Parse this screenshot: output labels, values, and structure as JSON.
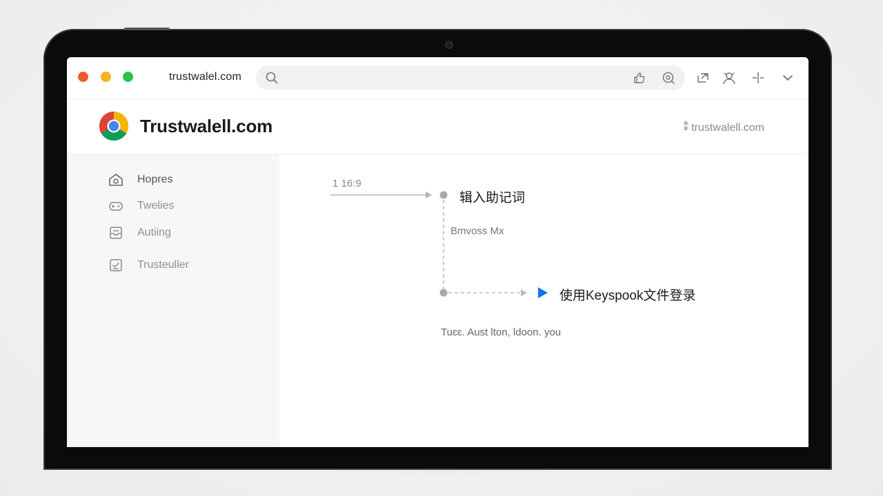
{
  "browser": {
    "url": "trustwalel.com",
    "search_placeholder": ""
  },
  "site": {
    "title": "Trustwalell.com",
    "link": "trustwalell.com"
  },
  "sidebar": {
    "items": [
      {
        "label": "Hopres",
        "icon": "home-icon"
      },
      {
        "label": "Twelies",
        "icon": "gamepad-icon"
      },
      {
        "label": "Autiing",
        "icon": "inbox-icon"
      },
      {
        "label": "Trusteuller",
        "icon": "checklist-icon"
      }
    ]
  },
  "flow": {
    "ratio_label": "1 16:9",
    "step1": "辑入助记词",
    "sub_label": "Bmvoss Mx",
    "step2": "使用Keyspook文件登录",
    "footer": "Tuɛɛ. Aust lton, ldoon. you"
  },
  "colors": {
    "close": "#f0582c",
    "minimize": "#f4b21d",
    "maximize": "#2bc24f",
    "accent": "#1a73e8"
  }
}
